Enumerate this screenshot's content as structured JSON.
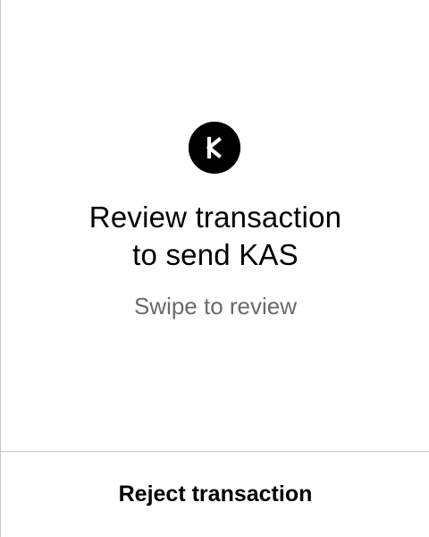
{
  "review": {
    "icon": "kaspa-logo-icon",
    "title_line1": "Review transaction",
    "title_line2": "to send KAS",
    "subtitle": "Swipe to review"
  },
  "footer": {
    "reject_label": "Reject transaction"
  },
  "colors": {
    "background": "#ffffff",
    "text": "#000000",
    "secondary_text": "#6a6a6a",
    "divider": "#c8c8c8"
  }
}
